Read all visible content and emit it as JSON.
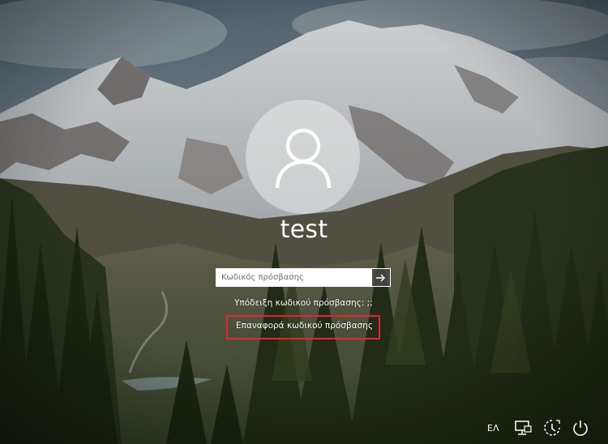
{
  "login": {
    "username": "test",
    "password_placeholder": "Κωδικός πρόσβασης",
    "password_value": "",
    "hint_text": "Υπόδειξη κωδικού πρόσβασης: ;;",
    "reset_link": "Επαναφορά κωδικού πρόσβασης"
  },
  "tray": {
    "language": "ΕΛ",
    "icons": [
      "network-icon",
      "ease-of-access-icon",
      "power-icon"
    ]
  },
  "colors": {
    "highlight_box": "#e0272a",
    "text": "#ffffff"
  }
}
